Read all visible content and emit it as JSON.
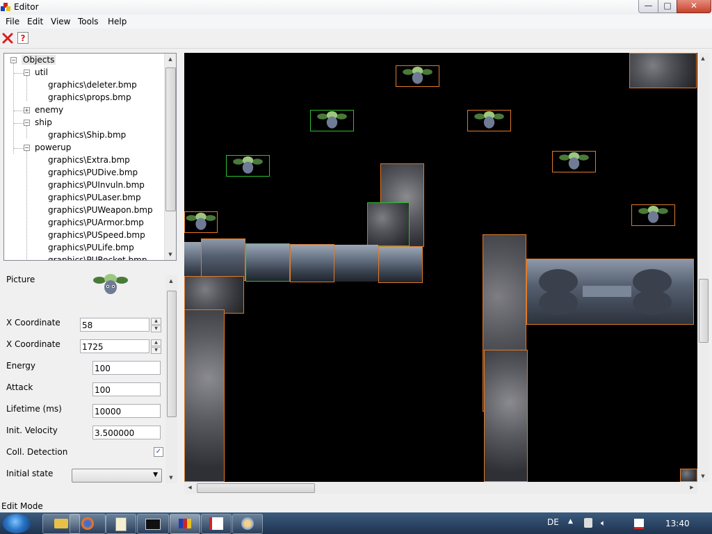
{
  "window": {
    "title": "Editor",
    "minimize_glyph": "—",
    "maximize_glyph": "□",
    "close_glyph": "✕"
  },
  "menu": [
    {
      "label": "File"
    },
    {
      "label": "Edit"
    },
    {
      "label": "View"
    },
    {
      "label": "Tools"
    },
    {
      "label": "Help"
    }
  ],
  "toolbar": {
    "delete_icon": "delete-x-icon",
    "help_icon": "help-question-icon",
    "help_glyph": "?"
  },
  "tree": {
    "root": "Objects",
    "nodes": {
      "util": "util",
      "util_children": [
        "graphics\\deleter.bmp",
        "graphics\\props.bmp"
      ],
      "enemy": "enemy",
      "ship": "ship",
      "ship_children": [
        "graphics\\Ship.bmp"
      ],
      "powerup": "powerup",
      "powerup_children": [
        "graphics\\Extra.bmp",
        "graphics\\PUDive.bmp",
        "graphics\\PUInvuln.bmp",
        "graphics\\PULaser.bmp",
        "graphics\\PUWeapon.bmp",
        "graphics\\PUArmor.bmp",
        "graphics\\PUSpeed.bmp",
        "graphics\\PULife.bmp",
        "graphics\\PURocket.bmp"
      ]
    }
  },
  "properties": {
    "picture_label": "Picture",
    "x_label": "X Coordinate",
    "x_value": "58",
    "y_label": "X Coordinate",
    "y_value": "1725",
    "energy_label": "Energy",
    "energy_value": "100",
    "attack_label": "Attack",
    "attack_value": "100",
    "lifetime_label": "Lifetime (ms)",
    "lifetime_value": "10000",
    "velocity_label": "Init. Velocity",
    "velocity_value": "3.500000",
    "collision_label": "Coll. Detection",
    "collision_checked": true,
    "collision_glyph": "✓",
    "initial_state_label": "Initial state",
    "initial_state_value": ""
  },
  "status": {
    "text": "Edit Mode"
  },
  "taskbar": {
    "apps": [
      "explorer-icon",
      "firefox-icon",
      "notepad-icon",
      "console-icon",
      "editor-app-icon",
      "image-tool-icon",
      "paint-icon"
    ],
    "language": "DE",
    "clock": "13:40"
  },
  "colors": {
    "selected_border": "#2ec02e",
    "object_border": "#e07b2a",
    "canvas_bg": "#000000"
  }
}
